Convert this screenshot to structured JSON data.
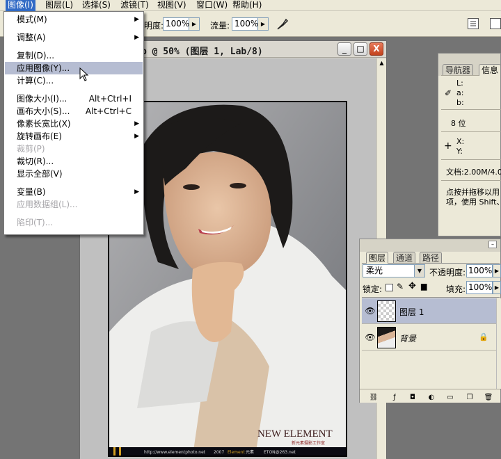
{
  "menubar": {
    "items": [
      "图像(I)",
      "图层(L)",
      "选择(S)",
      "滤镜(T)",
      "视图(V)",
      "窗口(W)",
      "帮助(H)"
    ],
    "active_index": 0
  },
  "options_bar": {
    "opacity_label": "明度:",
    "opacity_value": "100%",
    "flow_label": "流量:",
    "flow_value": "100%",
    "airbrush_icon": "airbrush-icon",
    "palette_icon": "palette-well-icon"
  },
  "document": {
    "title": "p @ 50% (图层 1, Lab/8)",
    "min_btn": "_",
    "max_btn": "□",
    "close_btn": "X",
    "watermark_brand": "NEW ELEMENT",
    "watermark_sub": "新元素摄影工作室",
    "footer_url": "http://www.elementphoto.net",
    "footer_year": "2007",
    "footer_brand": "Element",
    "footer_brand2": "元素",
    "footer_email": "ETON@263.net"
  },
  "image_menu": {
    "items": [
      {
        "label": "模式(M)",
        "submenu": true,
        "disabled": false,
        "shortcut": ""
      },
      {
        "sep": true
      },
      {
        "label": "调整(A)",
        "submenu": true,
        "disabled": false,
        "shortcut": ""
      },
      {
        "sep": true
      },
      {
        "label": "复制(D)...",
        "submenu": false,
        "disabled": false,
        "shortcut": ""
      },
      {
        "label": "应用图像(Y)...",
        "submenu": false,
        "disabled": false,
        "shortcut": "",
        "highlighted": true
      },
      {
        "label": "计算(C)...",
        "submenu": false,
        "disabled": false,
        "shortcut": ""
      },
      {
        "sep": true
      },
      {
        "label": "图像大小(I)...",
        "submenu": false,
        "disabled": false,
        "shortcut": "Alt+Ctrl+I"
      },
      {
        "label": "画布大小(S)...",
        "submenu": false,
        "disabled": false,
        "shortcut": "Alt+Ctrl+C"
      },
      {
        "label": "像素长宽比(X)",
        "submenu": true,
        "disabled": false,
        "shortcut": ""
      },
      {
        "label": "旋转画布(E)",
        "submenu": true,
        "disabled": false,
        "shortcut": ""
      },
      {
        "label": "裁剪(P)",
        "submenu": false,
        "disabled": true,
        "shortcut": ""
      },
      {
        "label": "裁切(R)...",
        "submenu": false,
        "disabled": false,
        "shortcut": ""
      },
      {
        "label": "显示全部(V)",
        "submenu": false,
        "disabled": false,
        "shortcut": ""
      },
      {
        "sep": true
      },
      {
        "label": "变量(B)",
        "submenu": true,
        "disabled": false,
        "shortcut": ""
      },
      {
        "label": "应用数据组(L)...",
        "submenu": false,
        "disabled": true,
        "shortcut": ""
      },
      {
        "sep": true
      },
      {
        "label": "陷印(T)...",
        "submenu": false,
        "disabled": true,
        "shortcut": ""
      }
    ]
  },
  "info_panel": {
    "tabs": [
      "导航器",
      "信息"
    ],
    "active_tab": 1,
    "l_label": "L:",
    "a_label": "a:",
    "b_label": "b:",
    "bit_depth": "8 位",
    "x_label": "X:",
    "y_label": "Y:",
    "doc_size": "文档:2.00M/4.0",
    "hint_line1": "点按并拖移以用",
    "hint_line2": "项，使用 Shift、"
  },
  "layers_panel": {
    "tabs": [
      "图层",
      "通道",
      "路径"
    ],
    "active_tab": 0,
    "blend_mode": "柔光",
    "opacity_label": "不透明度:",
    "opacity_value": "100%",
    "lock_label": "锁定:",
    "fill_label": "填充:",
    "fill_value": "100%",
    "layers": [
      {
        "name": "图层 1",
        "visible": true,
        "selected": true,
        "locked": false
      },
      {
        "name": "背景",
        "visible": true,
        "selected": false,
        "locked": true
      }
    ]
  }
}
